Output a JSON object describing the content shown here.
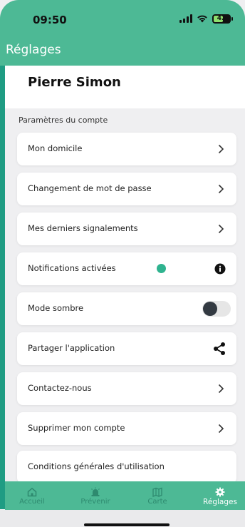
{
  "status_bar": {
    "time": "09:50",
    "battery": "42"
  },
  "header": {
    "title": "Réglages"
  },
  "profile": {
    "name": "Pierre Simon"
  },
  "section": {
    "label": "Paramètres du compte"
  },
  "items": [
    {
      "label": "Mon domicile",
      "trailing": "chevron-right-icon"
    },
    {
      "label": "Changement de mot de passe",
      "trailing": "chevron-right-icon"
    },
    {
      "label": "Mes derniers signalements",
      "trailing": "chevron-right-icon"
    },
    {
      "label": "Notifications activées",
      "trailing": "info-icon",
      "status_color": "#2fb38f"
    },
    {
      "label": "Mode sombre",
      "trailing": "toggle",
      "toggle_on": false
    },
    {
      "label": "Partager l'application",
      "trailing": "share-icon"
    },
    {
      "label": "Contactez-nous",
      "trailing": "chevron-right-icon"
    },
    {
      "label": "Supprimer mon compte",
      "trailing": "chevron-right-icon"
    },
    {
      "label": "Conditions générales d'utilisation",
      "trailing": "none"
    }
  ],
  "bottom_nav": {
    "tabs": [
      {
        "label": "Accueil",
        "icon": "home-icon",
        "active": false
      },
      {
        "label": "Prévenir",
        "icon": "alert-icon",
        "active": false
      },
      {
        "label": "Carte",
        "icon": "map-icon",
        "active": false
      },
      {
        "label": "Réglages",
        "icon": "gear-icon",
        "active": true
      }
    ]
  },
  "colors": {
    "accent": "#4db995",
    "accent_dark": "#1f9c83",
    "inactive_tab": "#2e8a6f"
  }
}
